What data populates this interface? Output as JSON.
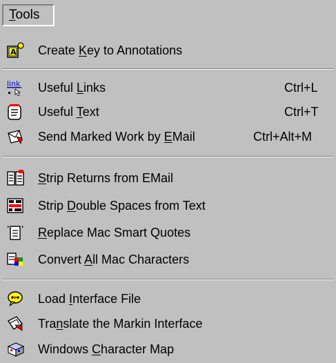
{
  "menubar": {
    "tools": {
      "pre": "",
      "accel": "T",
      "post": "ools"
    }
  },
  "menu": {
    "items": [
      {
        "name": "create-key",
        "pre": "Create ",
        "accel": "K",
        "post": "ey to Annotations",
        "shortcut": "",
        "icon": "annotation-key-icon"
      },
      {
        "name": "useful-links",
        "pre": "Useful ",
        "accel": "L",
        "post": "inks",
        "shortcut": "Ctrl+L",
        "icon": "link-icon"
      },
      {
        "name": "useful-text",
        "pre": "Useful ",
        "accel": "T",
        "post": "ext",
        "shortcut": "Ctrl+T",
        "icon": "notepad-icon"
      },
      {
        "name": "send-marked-work",
        "pre": "Send Marked Work by ",
        "accel": "E",
        "post": "Mail",
        "shortcut": "Ctrl+Alt+M",
        "icon": "email-send-icon"
      },
      {
        "name": "strip-returns",
        "pre": "",
        "accel": "S",
        "post": "trip Returns from EMail",
        "shortcut": "",
        "icon": "strip-returns-icon"
      },
      {
        "name": "strip-double-spaces",
        "pre": "Strip ",
        "accel": "D",
        "post": "ouble Spaces from Text",
        "shortcut": "",
        "icon": "strip-spaces-icon"
      },
      {
        "name": "replace-smart-quotes",
        "pre": "",
        "accel": "R",
        "post": "eplace Mac Smart Quotes",
        "shortcut": "",
        "icon": "smart-quotes-icon"
      },
      {
        "name": "convert-mac-characters",
        "pre": "Convert ",
        "accel": "A",
        "post": "ll Mac Characters",
        "shortcut": "",
        "icon": "convert-characters-icon"
      },
      {
        "name": "load-interface-file",
        "pre": "Load ",
        "accel": "I",
        "post": "nterface File",
        "shortcut": "",
        "icon": "speech-bubble-icon"
      },
      {
        "name": "translate-interface",
        "pre": "Tra",
        "accel": "n",
        "post": "slate the Markin Interface",
        "shortcut": "",
        "icon": "translate-icon"
      },
      {
        "name": "character-map",
        "pre": "Windows ",
        "accel": "C",
        "post": "haracter Map",
        "shortcut": "",
        "icon": "character-map-icon"
      }
    ]
  },
  "colors": {
    "menu_bg": "#c0c0c0",
    "separator_dark": "#808080",
    "separator_light": "#ffffff"
  }
}
